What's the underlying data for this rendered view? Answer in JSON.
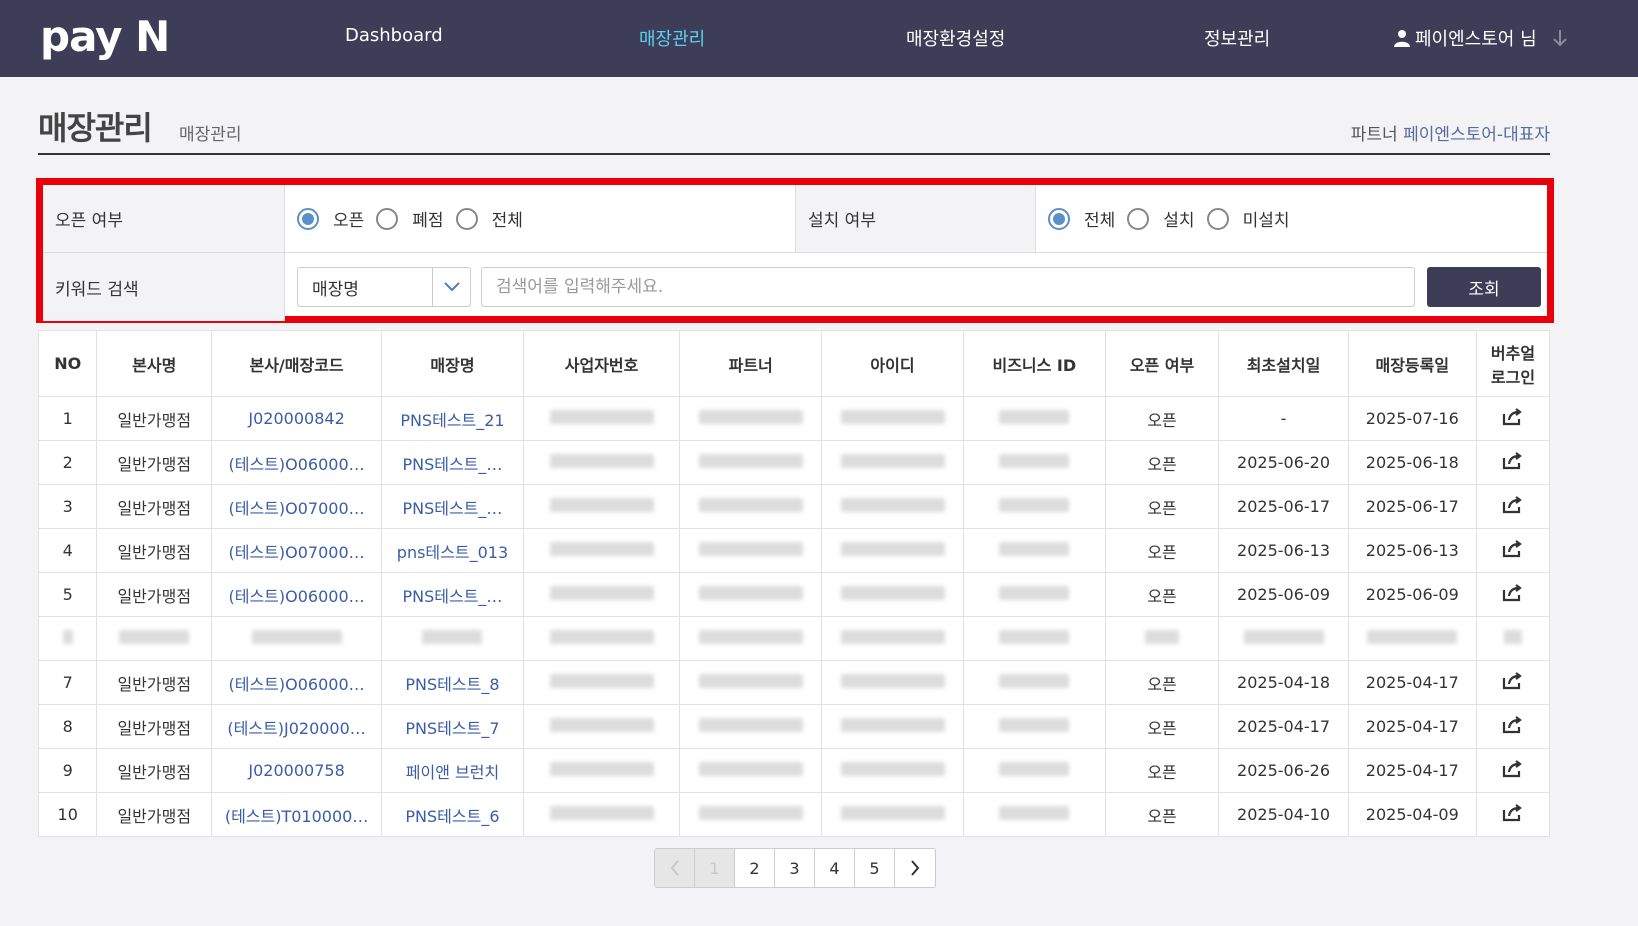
{
  "header": {
    "logo": "pay N",
    "nav": [
      "Dashboard",
      "매장관리",
      "매장환경설정",
      "정보관리"
    ],
    "active_nav": "매장관리",
    "user": "페이엔스토어 님"
  },
  "page": {
    "title": "매장관리",
    "breadcrumb": "매장관리",
    "partner_label": "파트너",
    "partner_value": "페이엔스토어-대표자"
  },
  "filter": {
    "open_label": "오픈 여부",
    "open_options": [
      "오픈",
      "폐점",
      "전체"
    ],
    "open_selected": "오픈",
    "install_label": "설치 여부",
    "install_options": [
      "전체",
      "설치",
      "미설치"
    ],
    "install_selected": "전체",
    "keyword_label": "키워드 검색",
    "keyword_select": "매장명",
    "search_placeholder": "검색어를 입력해주세요.",
    "search_button": "조회"
  },
  "table": {
    "headers": [
      "NO",
      "본사명",
      "본사/매장코드",
      "매장명",
      "사업자번호",
      "파트너",
      "아이디",
      "비즈니스 ID",
      "오픈 여부",
      "최초설치일",
      "매장등록일",
      "버추얼\n로그인"
    ],
    "rows": [
      {
        "no": "1",
        "hq": "일반가맹점",
        "code": "J020000842",
        "store": "PNS테스트_21",
        "open": "오픈",
        "first_install": "-",
        "registered": "2025-07-16"
      },
      {
        "no": "2",
        "hq": "일반가맹점",
        "code": "(테스트)O06000…",
        "store": "PNS테스트_…",
        "open": "오픈",
        "first_install": "2025-06-20",
        "registered": "2025-06-18"
      },
      {
        "no": "3",
        "hq": "일반가맹점",
        "code": "(테스트)O07000…",
        "store": "PNS테스트_…",
        "open": "오픈",
        "first_install": "2025-06-17",
        "registered": "2025-06-17"
      },
      {
        "no": "4",
        "hq": "일반가맹점",
        "code": "(테스트)O07000…",
        "store": "pns테스트_013",
        "open": "오픈",
        "first_install": "2025-06-13",
        "registered": "2025-06-13"
      },
      {
        "no": "5",
        "hq": "일반가맹점",
        "code": "(테스트)O06000…",
        "store": "PNS테스트_…",
        "open": "오픈",
        "first_install": "2025-06-09",
        "registered": "2025-06-09"
      },
      {
        "no": "",
        "hq": "",
        "code": "",
        "store": "",
        "open": "",
        "first_install": "",
        "registered": "",
        "blurred": true
      },
      {
        "no": "7",
        "hq": "일반가맹점",
        "code": "(테스트)O06000…",
        "store": "PNS테스트_8",
        "open": "오픈",
        "first_install": "2025-04-18",
        "registered": "2025-04-17"
      },
      {
        "no": "8",
        "hq": "일반가맹점",
        "code": "(테스트)J020000…",
        "store": "PNS테스트_7",
        "open": "오픈",
        "first_install": "2025-04-17",
        "registered": "2025-04-17"
      },
      {
        "no": "9",
        "hq": "일반가맹점",
        "code": "J020000758",
        "store": "페이앤 브런치",
        "open": "오픈",
        "first_install": "2025-06-26",
        "registered": "2025-04-17"
      },
      {
        "no": "10",
        "hq": "일반가맹점",
        "code": "(테스트)T010000…",
        "store": "PNS테스트_6",
        "open": "오픈",
        "first_install": "2025-04-10",
        "registered": "2025-04-09"
      }
    ]
  },
  "pagination": {
    "pages": [
      "1",
      "2",
      "3",
      "4",
      "5"
    ],
    "current": "1"
  },
  "colors": {
    "header_bg": "#3e3d58",
    "active_nav": "#5bd0f0",
    "highlight_border": "#e8000b",
    "link": "#3a5da8"
  }
}
